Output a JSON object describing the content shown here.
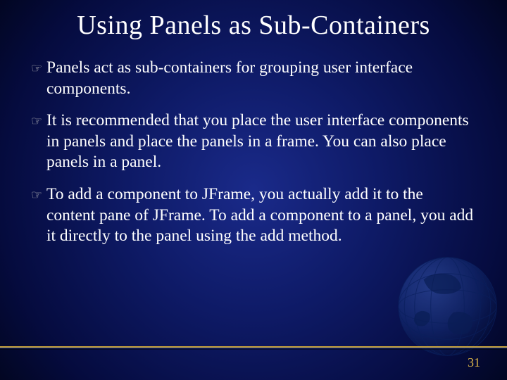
{
  "slide": {
    "title": "Using Panels as Sub-Containers",
    "bullets": [
      "Panels act as sub-containers for grouping user interface components.",
      "It is recommended that you place the user interface components in panels and place the panels in a frame. You can also place panels in a panel.",
      "To add a component to JFrame, you actually add it to the content pane of JFrame. To add a component to a panel, you add it directly to the panel using the add method."
    ],
    "page_number": "31",
    "bullet_glyph": "☞"
  },
  "colors": {
    "accent_gold": "#e2b84a",
    "title_white": "#ffffff",
    "body_white": "#ffffff"
  }
}
